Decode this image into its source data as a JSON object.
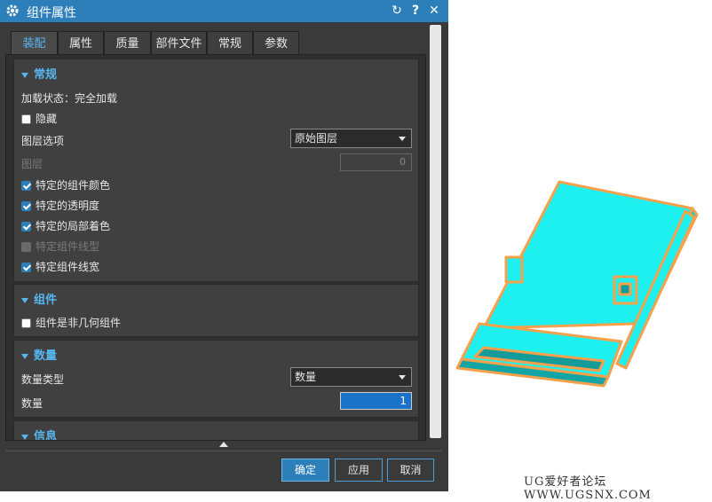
{
  "dialog": {
    "title": "组件属性",
    "buttons": {
      "reset": "↻",
      "help": "?",
      "close": "✕"
    }
  },
  "tabs": [
    {
      "label": "装配",
      "active": true
    },
    {
      "label": "属性",
      "active": false
    },
    {
      "label": "质量",
      "active": false
    },
    {
      "label": "部件文件",
      "active": false
    },
    {
      "label": "常规",
      "active": false
    },
    {
      "label": "参数",
      "active": false
    }
  ],
  "general": {
    "header": "常规",
    "load_status": "加载状态：完全加载",
    "hide_label": "隐藏",
    "hide_checked": false,
    "layer_option_label": "图层选项",
    "layer_option_value": "原始图层",
    "layer_label": "图层",
    "layer_value": "0",
    "checks": [
      {
        "label": "特定的组件颜色",
        "checked": true,
        "disabled": false
      },
      {
        "label": "特定的透明度",
        "checked": true,
        "disabled": false
      },
      {
        "label": "特定的局部着色",
        "checked": true,
        "disabled": false
      },
      {
        "label": "特定组件线型",
        "checked": false,
        "disabled": true
      },
      {
        "label": "特定组件线宽",
        "checked": true,
        "disabled": false
      }
    ]
  },
  "component": {
    "header": "组件",
    "non_geometric_label": "组件是非几何组件",
    "non_geometric_checked": false
  },
  "quantity": {
    "header": "数量",
    "type_label": "数量类型",
    "type_value": "数量",
    "count_label": "数量",
    "count_value": "1"
  },
  "info": {
    "header": "信息"
  },
  "footer": {
    "ok": "确定",
    "apply": "应用",
    "cancel": "取消"
  },
  "watermark": "UG爱好者论坛 WWW.UGSNX.COM",
  "colors": {
    "accent": "#2c7fb8",
    "model_fill": "#1ef0f0",
    "model_edge": "#f5a04a"
  }
}
